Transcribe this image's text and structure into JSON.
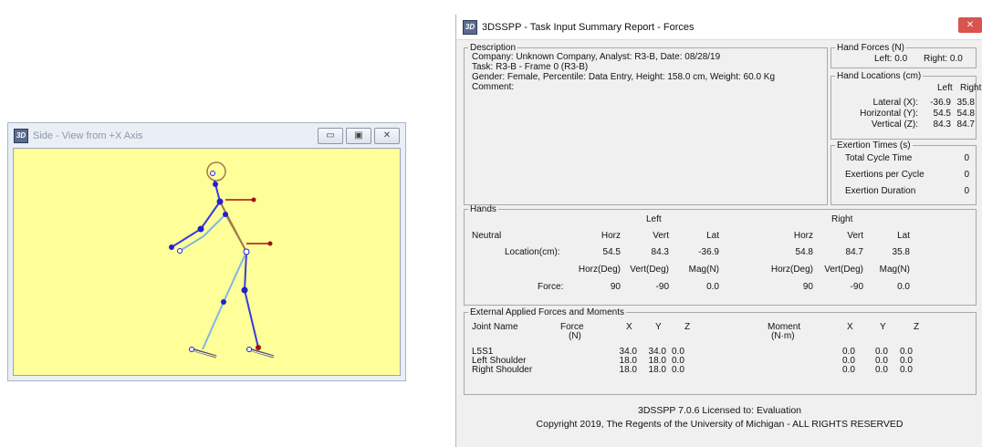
{
  "side_window": {
    "title": "Side - View from +X Axis",
    "icon_text": "3D",
    "controls": {
      "minimize": "▭",
      "maximize": "▣",
      "close": "✕"
    },
    "canvas_bg": "#ffff99"
  },
  "report_window": {
    "title": "3DSSPP - Task Input Summary Report - Forces",
    "icon_text": "3D",
    "close": "✕",
    "description": {
      "legend": "Description",
      "lines": [
        "Company: Unknown Company, Analyst: R3-B, Date: 08/28/19",
        "Task: R3-B - Frame 0 (R3-B)",
        "Gender: Female, Percentile: Data Entry, Height: 158.0 cm, Weight: 60.0 Kg",
        "Comment:"
      ]
    },
    "hand_forces": {
      "legend": "Hand Forces (N)",
      "left": "Left: 0.0",
      "right": "Right:  0.0"
    },
    "hand_locations": {
      "legend": "Hand Locations (cm)",
      "col_left": "Left",
      "col_right": "Right",
      "rows": [
        {
          "label": "Lateral (X):",
          "left": "-36.9",
          "right": "35.8"
        },
        {
          "label": "Horizontal (Y):",
          "left": "54.5",
          "right": "54.8"
        },
        {
          "label": "Vertical (Z):",
          "left": "84.3",
          "right": "84.7"
        }
      ]
    },
    "exertion": {
      "legend": "Exertion Times (s)",
      "rows": [
        {
          "label": "Total Cycle Time",
          "value": "0"
        },
        {
          "label": "Exertions per Cycle",
          "value": "0"
        },
        {
          "label": "Exertion Duration",
          "value": "0"
        }
      ]
    },
    "hands": {
      "legend": "Hands",
      "left_title": "Left",
      "right_title": "Right",
      "neutral": "Neutral",
      "location_label": "Location(cm):",
      "force_label": "Force:",
      "hdr1": [
        "Horz",
        "Vert",
        "Lat"
      ],
      "hdr2": [
        "Horz(Deg)",
        "Vert(Deg)",
        "Mag(N)"
      ],
      "left_location": [
        "54.5",
        "84.3",
        "-36.9"
      ],
      "right_location": [
        "54.8",
        "84.7",
        "35.8"
      ],
      "left_force": [
        "90",
        "-90",
        "0.0"
      ],
      "right_force": [
        "90",
        "-90",
        "0.0"
      ]
    },
    "external": {
      "legend": "External Applied Forces and Moments",
      "joint_name": "Joint Name",
      "force_label": "Force",
      "force_unit": "(N)",
      "moment_label": "Moment",
      "moment_unit": "(N·m)",
      "axes": [
        "X",
        "Y",
        "Z"
      ],
      "rows": [
        {
          "name": "L5S1",
          "fx": "34.0",
          "fy": "34.0",
          "fz": "0.0",
          "mx": "0.0",
          "my": "0.0",
          "mz": "0.0"
        },
        {
          "name": "Left Shoulder",
          "fx": "18.0",
          "fy": "18.0",
          "fz": "0.0",
          "mx": "0.0",
          "my": "0.0",
          "mz": "0.0"
        },
        {
          "name": "Right Shoulder",
          "fx": "18.0",
          "fy": "18.0",
          "fz": "0.0",
          "mx": "0.0",
          "my": "0.0",
          "mz": "0.0"
        }
      ]
    },
    "footer": {
      "line1": "3DSSPP 7.0.6 Licensed to: Evaluation",
      "line2": "Copyright 2019, The Regents of the University of Michigan - ALL RIGHTS RESERVED"
    }
  }
}
